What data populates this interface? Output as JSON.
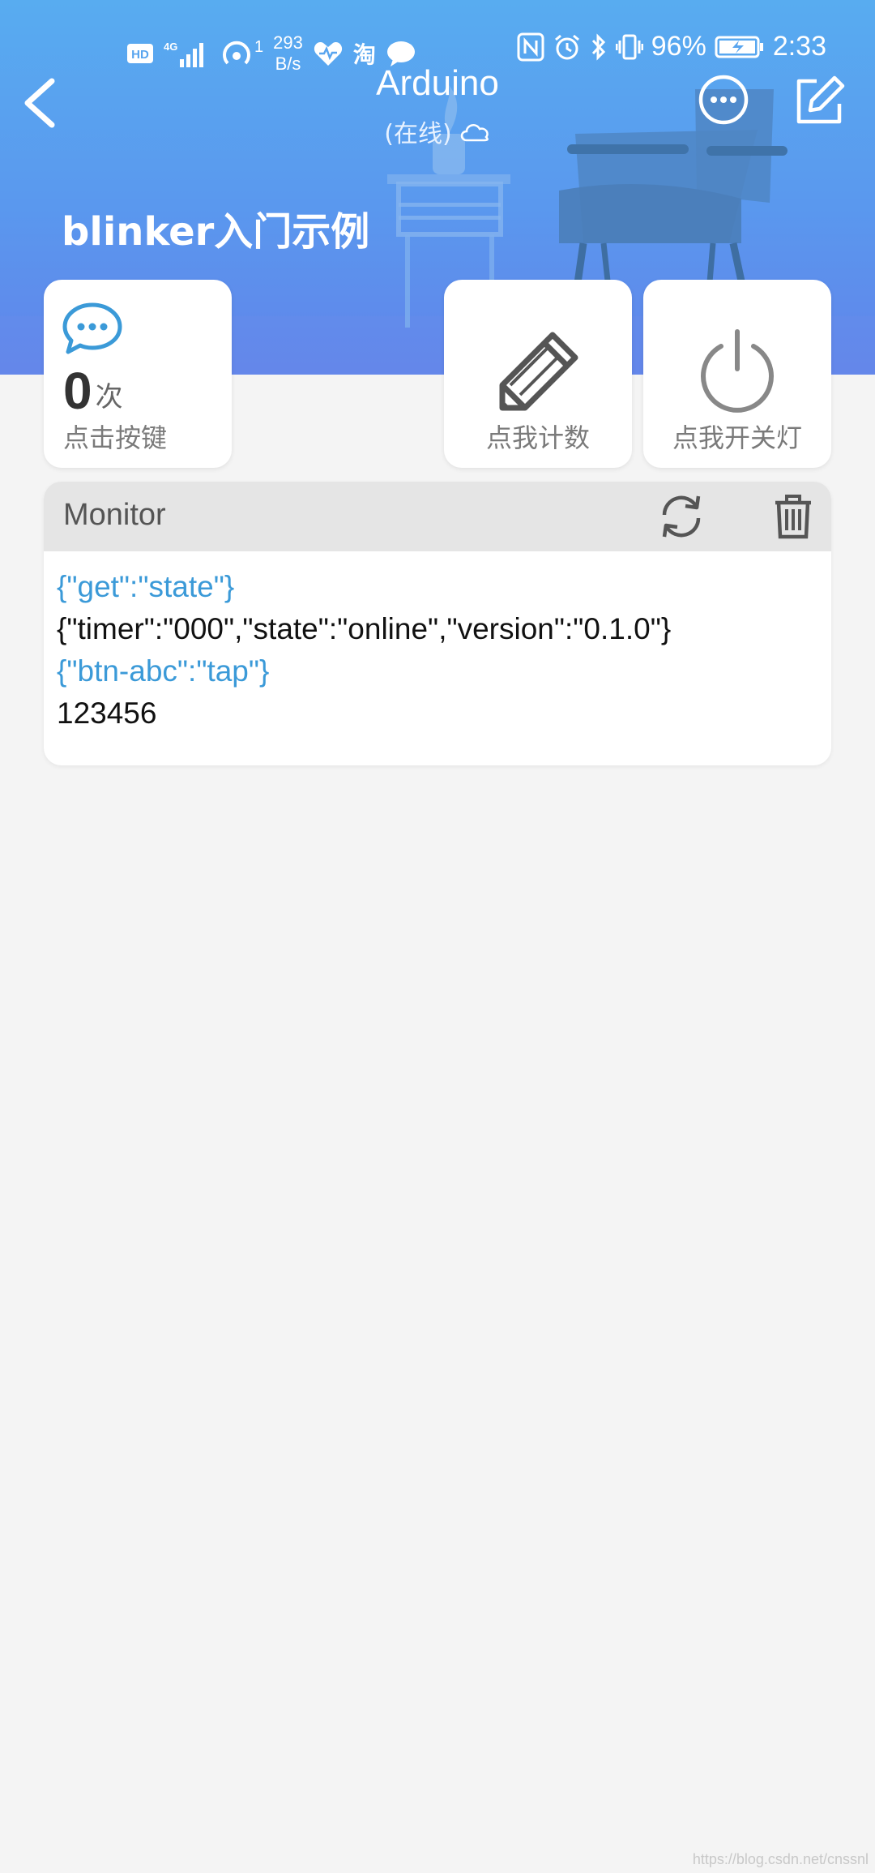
{
  "status_bar": {
    "network_rate_value": "293",
    "network_rate_unit": "B/s",
    "hotspot_count": "1",
    "taobao_icon_text": "淘",
    "battery_percent": "96%",
    "time": "2:33"
  },
  "header": {
    "title": "Arduino",
    "subtitle": "(在线)",
    "page_heading": "blinker入门示例"
  },
  "widgets": [
    {
      "count": "0",
      "unit": "次",
      "label": "点击按键",
      "icon": "chat-bubble-icon"
    },
    {
      "label": "点我计数",
      "icon": "pencil-icon"
    },
    {
      "label": "点我开关灯",
      "icon": "power-icon"
    }
  ],
  "monitor": {
    "title": "Monitor",
    "lines": [
      {
        "text": "{\"get\":\"state\"}",
        "direction": "sent"
      },
      {
        "text": "{\"timer\":\"000\",\"state\":\"online\",\"version\":\"0.1.0\"}",
        "direction": "received"
      },
      {
        "text": "{\"btn-abc\":\"tap\"}",
        "direction": "sent"
      },
      {
        "text": "123456",
        "direction": "received"
      }
    ]
  },
  "colors": {
    "header_gradient_top": "#58acf0",
    "header_gradient_bottom": "#6184ea",
    "accent_blue": "#3b9ad8",
    "page_background": "#f4f4f4"
  },
  "watermark": "https://blog.csdn.net/cnssnl"
}
